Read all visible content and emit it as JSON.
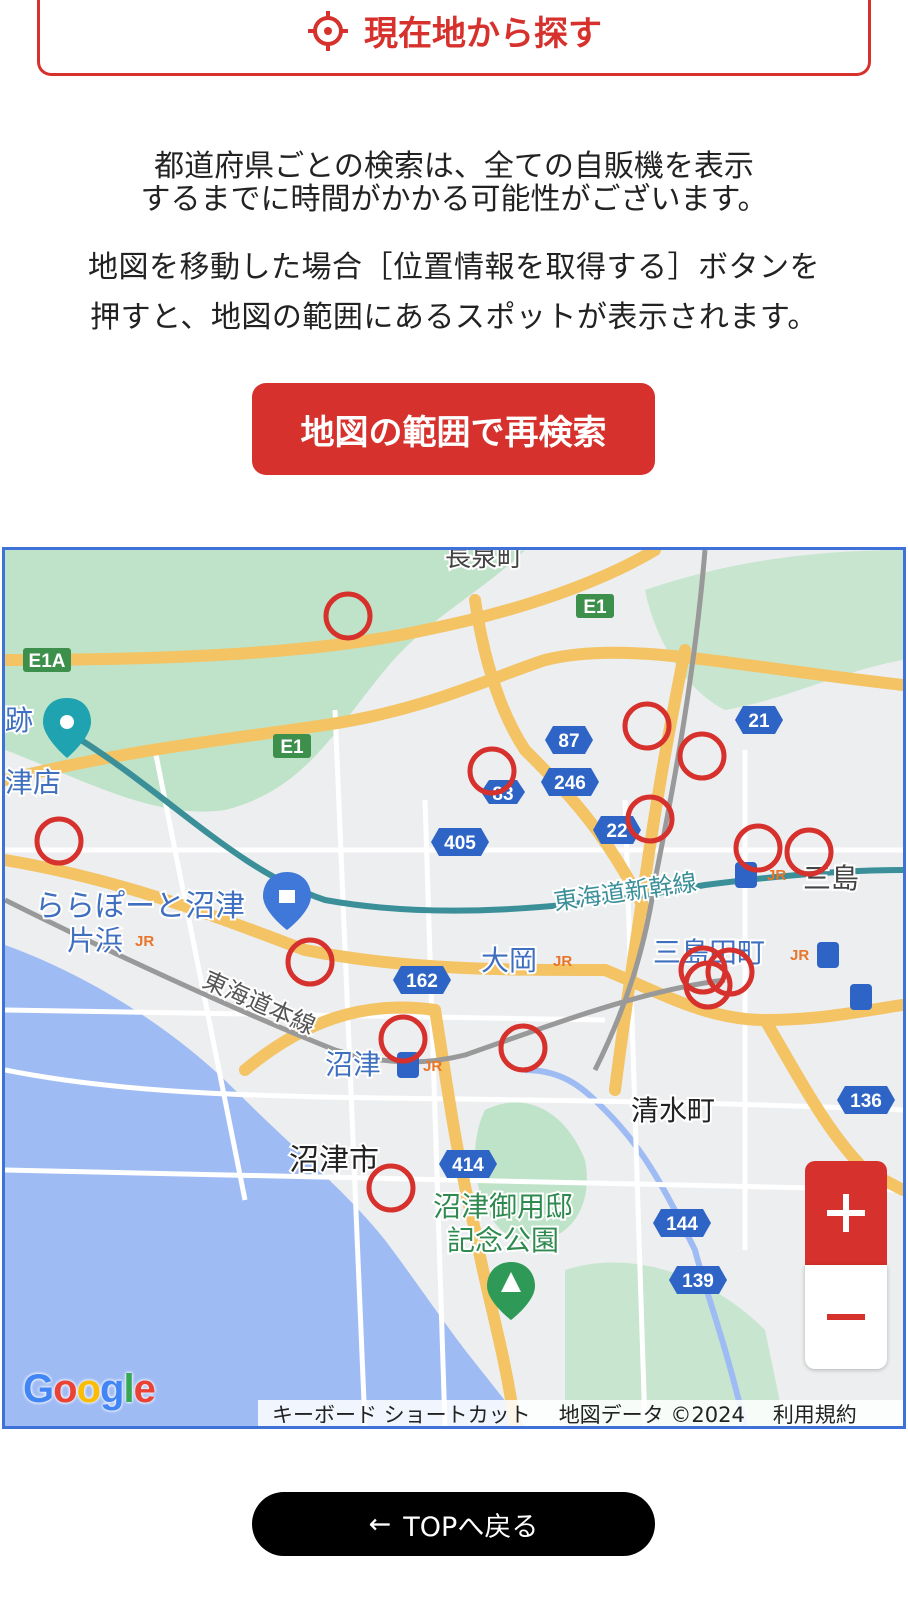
{
  "locate_button": {
    "label": "現在地から探す",
    "icon": "crosshair-icon"
  },
  "notice": {
    "line1": "都道府県ごとの検索は、全ての自販機を表示",
    "line2": "するまでに時間がかかる可能性がございます。",
    "line3": "地図を移動した場合［位置情報を取得する］ボタンを",
    "line4": "押すと、地図の範囲にあるスポットが表示されます。"
  },
  "research_button": {
    "label": "地図の範囲で再検索"
  },
  "map": {
    "place_labels": {
      "nagaizumi": "長泉町",
      "mishima": "三島",
      "lalaport": "ららぽーと沼津",
      "katahama": "片浜",
      "ooka": "大岡",
      "mishima_tamachi": "三島田町",
      "numazu": "沼津",
      "numazu_city": "沼津市",
      "shimizu": "清水町",
      "goyotei_1": "沼津御用邸",
      "goyotei_2": "記念公園",
      "tokaido_shinkansen": "東海道新幹線",
      "tokaido_line": "東海道本線",
      "ato": "跡",
      "tsu_ten": "津店"
    },
    "route_labels": {
      "e1": "E1",
      "e1a": "E1A",
      "r21": "21",
      "r87": "87",
      "r83": "83",
      "r246": "246",
      "r22": "22",
      "r405": "405",
      "r162": "162",
      "r414": "414",
      "r144": "144",
      "r139": "139",
      "r136": "136"
    },
    "jr_label": "JR",
    "attribution": {
      "shortcuts": "キーボード ショートカット",
      "map_data": "地図データ ©2024",
      "terms": "利用規約"
    },
    "google_logo": "Google",
    "marker_color": "#d6312c",
    "accent_color": "#d6312c"
  },
  "top_button": {
    "arrow": "←",
    "label": "TOPへ戻る"
  }
}
